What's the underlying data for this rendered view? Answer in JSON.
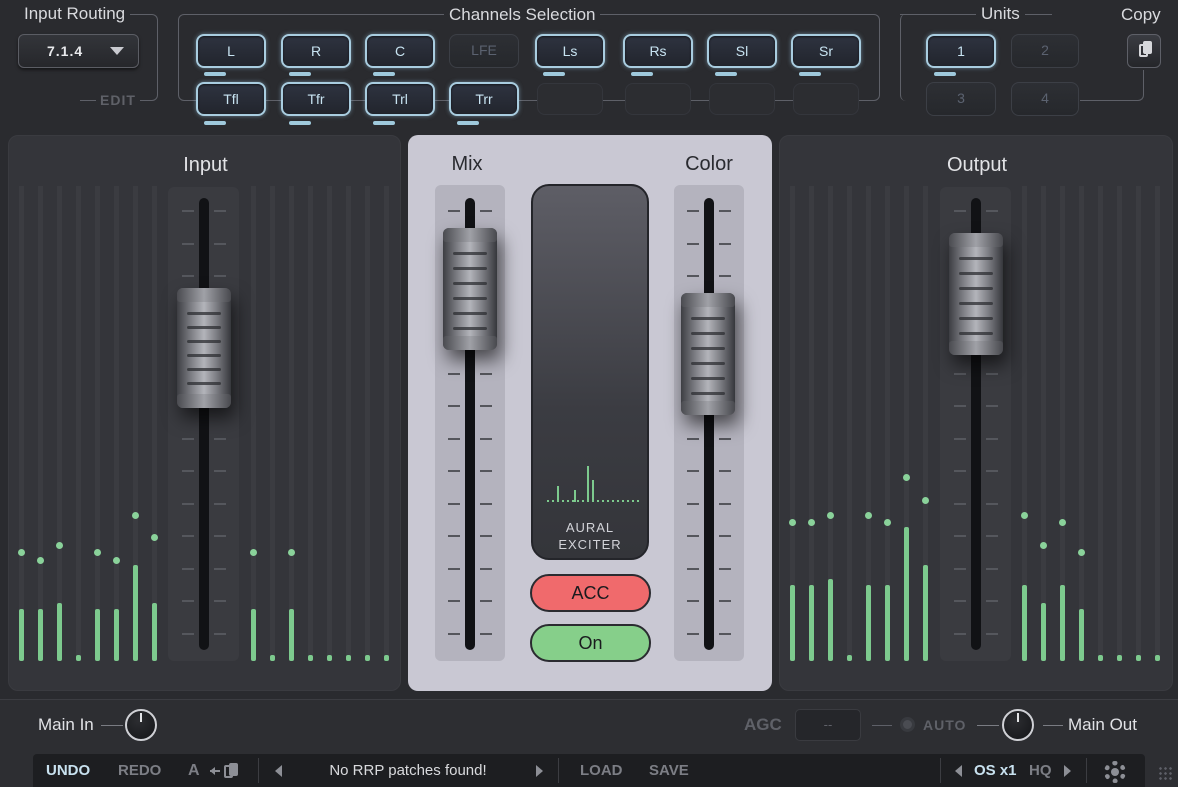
{
  "top": {
    "input_routing": {
      "title": "Input Routing",
      "value": "7.1.4",
      "edit_label": "EDIT"
    },
    "channels": {
      "title": "Channels Selection",
      "row1": [
        "L",
        "R",
        "C",
        "LFE",
        "Ls",
        "Rs",
        "Sl",
        "Sr"
      ],
      "row2": [
        "Tfl",
        "Tfr",
        "Trl",
        "Trr"
      ]
    },
    "units": {
      "title": "Units",
      "items": [
        "1",
        "2",
        "3",
        "4"
      ]
    },
    "copy_label": "Copy"
  },
  "panels": {
    "input_title": "Input",
    "mix_title": "Mix",
    "color_title": "Color",
    "output_title": "Output",
    "exciter_line1": "AURAL",
    "exciter_line2": "EXCITER",
    "acc_label": "ACC",
    "on_label": "On"
  },
  "bottom": {
    "main_in": "Main In",
    "agc_label": "AGC",
    "agc_value": "--",
    "auto_label": "AUTO",
    "main_out": "Main Out"
  },
  "toolbar": {
    "undo": "UNDO",
    "redo": "REDO",
    "ab": "A",
    "patch_status": "No RRP patches found!",
    "load": "LOAD",
    "save": "SAVE",
    "os": "OS x1",
    "hq": "HQ"
  },
  "colors": {
    "meter_green": "#7dca8e",
    "channel_outline": "#a9cde0",
    "acc_red": "#f06a6c",
    "on_green": "#86cf8a"
  }
}
